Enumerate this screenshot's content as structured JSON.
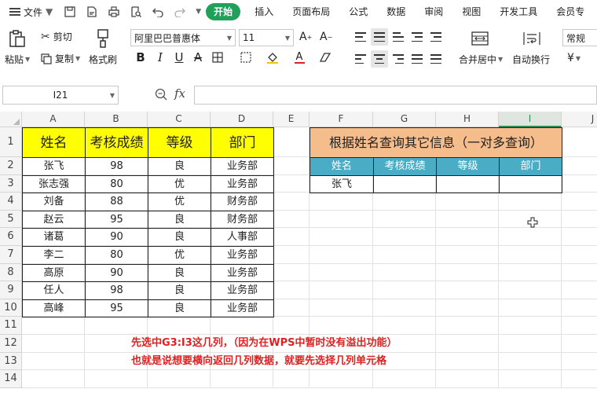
{
  "ribbon": {
    "file_label": "文件",
    "tabs": [
      "开始",
      "插入",
      "页面布局",
      "公式",
      "数据",
      "审阅",
      "视图",
      "开发工具",
      "会员专"
    ]
  },
  "toolbar": {
    "paste_label": "粘贴",
    "cut_label": "剪切",
    "copy_label": "复制",
    "format_painter_label": "格式刷",
    "font_name": "阿里巴巴普惠体",
    "font_size": "11",
    "merge_label": "合并居中",
    "wrap_label": "自动换行",
    "number_format": "常规",
    "currency_symbol": "¥"
  },
  "formula_bar": {
    "cell_ref": "I21",
    "fx_label": "fx",
    "formula": ""
  },
  "sheet": {
    "columns": [
      "A",
      "B",
      "C",
      "D",
      "E",
      "F",
      "G",
      "H",
      "I",
      "J"
    ],
    "rows": [
      "1",
      "2",
      "3",
      "4",
      "5",
      "6",
      "7",
      "8",
      "9",
      "10",
      "11",
      "12",
      "13",
      "14"
    ],
    "table1_headers": [
      "姓名",
      "考核成绩",
      "等级",
      "部门"
    ],
    "table1_rows": [
      [
        "张飞",
        "98",
        "良",
        "业务部"
      ],
      [
        "张志强",
        "80",
        "优",
        "业务部"
      ],
      [
        "刘备",
        "88",
        "优",
        "财务部"
      ],
      [
        "赵云",
        "95",
        "良",
        "财务部"
      ],
      [
        "诸葛",
        "90",
        "良",
        "人事部"
      ],
      [
        "李二",
        "80",
        "优",
        "业务部"
      ],
      [
        "高原",
        "90",
        "良",
        "业务部"
      ],
      [
        "任人",
        "98",
        "良",
        "业务部"
      ],
      [
        "高峰",
        "95",
        "良",
        "业务部"
      ]
    ],
    "lookup_title": "根据姓名查询其它信息（一对多查询）",
    "lookup_headers": [
      "姓名",
      "考核成绩",
      "等级",
      "部门"
    ],
    "lookup_name": "张飞"
  },
  "annotation": {
    "line1": "先选中G3:I3这几列，（因为在WPS中暂时没有溢出功能）",
    "line2": "也就是说想要横向返回几列数据，就要先选择几列单元格"
  },
  "colors": {
    "accent_green": "#20a05b",
    "header_yellow": "#ffff00",
    "title_orange": "#f5bc8c",
    "header_teal": "#4bacc6",
    "note_red": "#e02020"
  }
}
